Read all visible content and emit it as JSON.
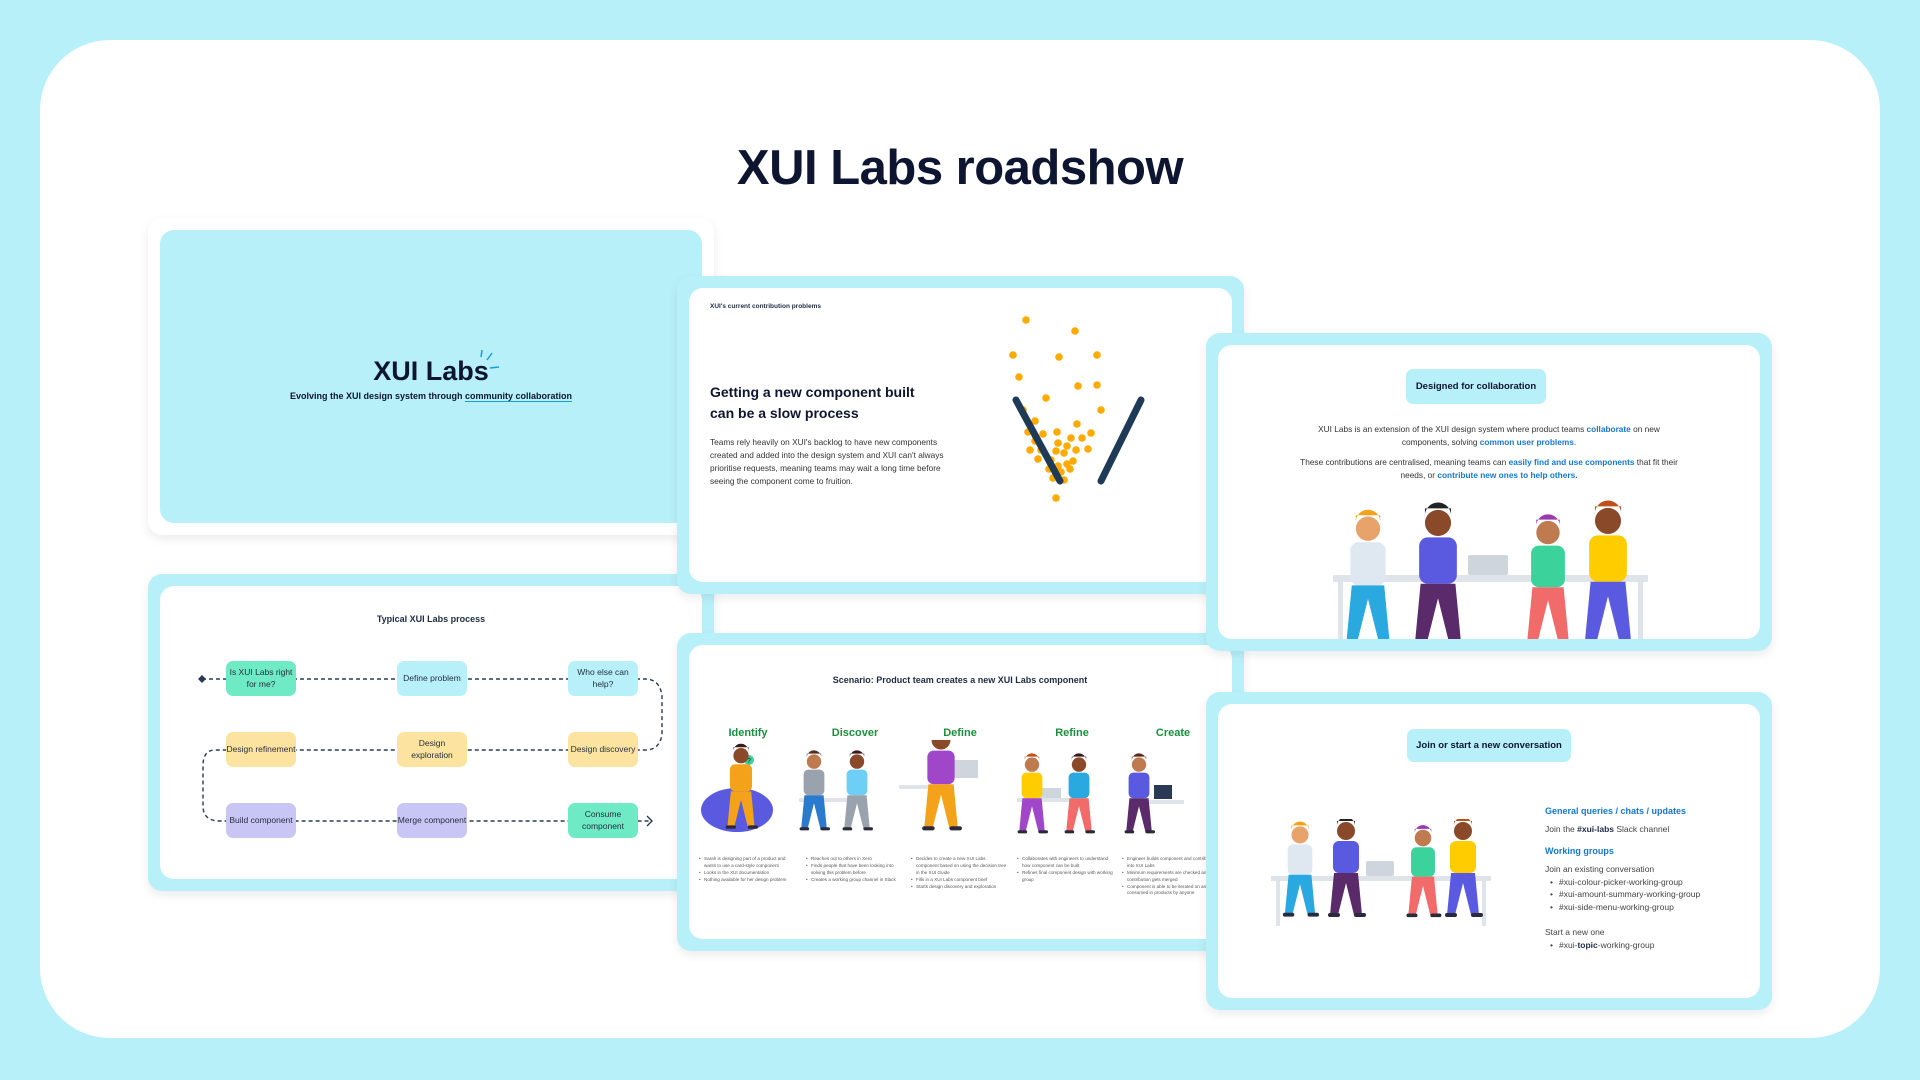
{
  "page_title": "XUI Labs roadshow",
  "slide_title": {
    "logo": "XUI Labs",
    "subtitle_prefix": "Evolving the XUI design system through ",
    "subtitle_highlight": "community collaboration"
  },
  "slide_problem": {
    "eyebrow": "XUI's current contribution problems",
    "heading_line1": "Getting a new component built",
    "heading_line2": "can be a slow process",
    "body": "Teams rely heavily on XUI's backlog to have new components created and added into the design system and XUI can't always prioritise requests, meaning teams may wait a long time before seeing the component come to fruition."
  },
  "slide_collab": {
    "badge": "Designed for collaboration",
    "p1": [
      "XUI Labs is an extension of the XUI design system where product teams ",
      "collaborate",
      " on new components, solving ",
      "common user problems",
      "."
    ],
    "p2": [
      "These contributions are centralised, meaning teams can ",
      "easily find and use components",
      " that fit their needs, or ",
      "contribute new ones to help others."
    ]
  },
  "slide_process": {
    "title": "Typical XUI Labs process",
    "steps": [
      {
        "label": "Is XUI Labs right for me?",
        "color": "#6eeac4"
      },
      {
        "label": "Define problem",
        "color": "#b8f0f9"
      },
      {
        "label": "Who else can help?",
        "color": "#b8f0f9"
      },
      {
        "label": "Design discovery",
        "color": "#fde3a0"
      },
      {
        "label": "Design exploration",
        "color": "#fde3a0"
      },
      {
        "label": "Design refinement",
        "color": "#fde3a0"
      },
      {
        "label": "Build component",
        "color": "#c9c5f5"
      },
      {
        "label": "Merge component",
        "color": "#c9c5f5"
      },
      {
        "label": "Consume component",
        "color": "#6eeac4"
      }
    ]
  },
  "slide_scenario": {
    "title": "Scenario: Product team creates a new XUI Labs component",
    "stages": [
      {
        "name": "Identify",
        "bullets": [
          "Sarah is designing part of a product and wants to use a card-style component",
          "Looks in the XUI documentation",
          "Nothing available for her design problem"
        ]
      },
      {
        "name": "Discover",
        "bullets": [
          "Reaches out to others in Xero",
          "Finds people that have been looking into solving this problem before",
          "Creates a working group channel in Slack"
        ]
      },
      {
        "name": "Define",
        "bullets": [
          "Decides to create a new XUI Labs component based on using the decision tree in the XUI Guide",
          "Fills in a XUI Labs component brief",
          "Starts design discovery and exploration"
        ]
      },
      {
        "name": "Refine",
        "bullets": [
          "Collaborates with engineers to understand how component can be built",
          "Refines final component design with working group"
        ]
      },
      {
        "name": "Create",
        "bullets": [
          "Engineer builds component and contributes it into XUI Labs",
          "Minimum requirements are checked and contribution gets merged",
          "Component is able to be iterated on and consumed in products by anyone"
        ]
      }
    ]
  },
  "slide_join": {
    "badge": "Join or start a new conversation",
    "general_heading": "General queries / chats / updates",
    "join_prefix": "Join the ",
    "join_channel": "#xui-labs",
    "join_suffix": " Slack channel",
    "working_heading": "Working groups",
    "existing_label": "Join an existing conversation",
    "existing": [
      "#xui-colour-picker-working-group",
      "#xui-amount-summary-working-group",
      "#xui-side-menu-working-group"
    ],
    "new_label": "Start a new one",
    "new_prefix": "#xui-",
    "new_topic": "topic",
    "new_suffix": "-working-group"
  },
  "colors": {
    "background": "#b8f0f9",
    "accent_blue": "#1677d2",
    "stage_green": "#1a8f3c",
    "dots": "#ffaa00",
    "navy": "#1f3a56"
  }
}
